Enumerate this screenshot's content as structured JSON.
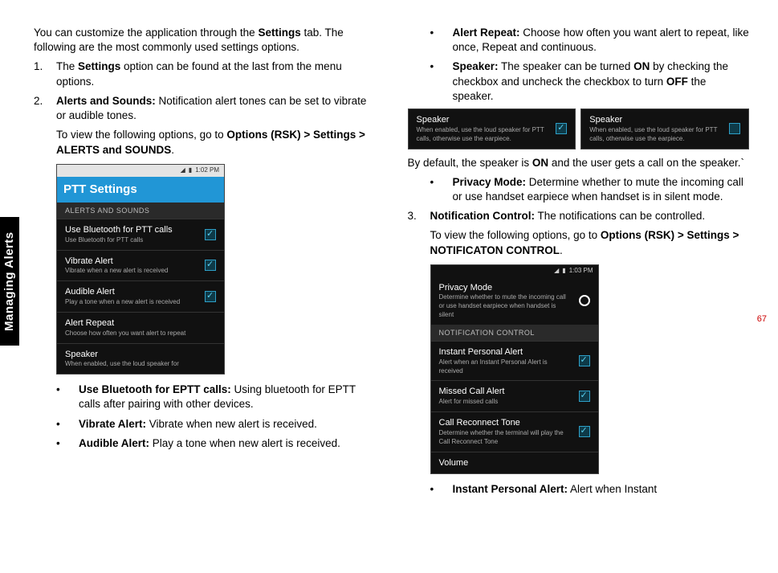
{
  "side_tab": "Managing Alerts",
  "page_number": "67",
  "col1": {
    "intro_a": "You can customize the application through the ",
    "intro_b": "Settings",
    "intro_c": " tab. The following are the most commonly used settings options.",
    "li1_num": "1.",
    "li1_a": "The ",
    "li1_b": "Settings",
    "li1_c": " option can be found at the last from the menu options.",
    "li2_num": "2.",
    "li2_a": "Alerts and Sounds:",
    "li2_b": " Notification alert tones can be set to vibrate or audible tones.",
    "li2_sub_a": "To view the following options, go to ",
    "li2_sub_b": "Options (RSK) > Settings > ALERTS and SOUNDS",
    "li2_sub_c": ".",
    "b1_t": "Use Bluetooth for EPTT calls:",
    "b1_d": " Using bluetooth for EPTT calls after pairing with other devices.",
    "b2_t": "Vibrate Alert:",
    "b2_d": " Vibrate when new alert is received.",
    "b3_t": "Audible Alert:",
    "b3_d": " Play a tone when new alert is received."
  },
  "shot1": {
    "time": "1:02 PM",
    "title": "PTT Settings",
    "section": "ALERTS AND SOUNDS",
    "r1t": "Use Bluetooth for PTT calls",
    "r1s": "Use Bluetooth for PTT calls",
    "r2t": "Vibrate Alert",
    "r2s": "Vibrate when a new alert is received",
    "r3t": "Audible Alert",
    "r3s": "Play a tone when a new alert is received",
    "r4t": "Alert Repeat",
    "r4s": "Choose how often you want alert to repeat",
    "r5t": "Speaker",
    "r5s": "When enabled, use the loud speaker for"
  },
  "col2": {
    "b4_t": "Alert Repeat:",
    "b4_d": " Choose how often you want alert to repeat, like once, Repeat and continuous.",
    "b5_t": "Speaker:",
    "b5_da": " The speaker can be turned ",
    "b5_on": "ON",
    "b5_db": " by checking the checkbox and uncheck the checkbox to turn ",
    "b5_off": "OFF",
    "b5_dc": " the speaker.",
    "speaker_note_a": "By default, the speaker is ",
    "speaker_note_b": "ON",
    "speaker_note_c": " and the user gets a call on the speaker.`",
    "b6_t": "Privacy Mode:",
    "b6_d": " Determine whether to mute the incoming call or use handset earpiece when handset is in silent mode.",
    "li3_num": "3.",
    "li3_a": "Notification Control:",
    "li3_b": " The notifications can be controlled.",
    "li3_sub_a": "To view the following options, go to ",
    "li3_sub_b": "Options (RSK) > Settings > NOTIFICATON CONTROL",
    "li3_sub_c": ".",
    "b7_t": "Instant Personal Alert:",
    "b7_d": " Alert when Instant"
  },
  "speaker_shots": {
    "title": "Speaker",
    "sub": "When enabled, use the loud speaker for PTT calls, otherwise use the earpiece."
  },
  "shot2": {
    "time": "1:03 PM",
    "r0t": "Privacy Mode",
    "r0s": "Determine whether to mute the incoming call or use handset earpiece when handset is silent",
    "section": "NOTIFICATION CONTROL",
    "r1t": "Instant Personal Alert",
    "r1s": "Alert when an Instant Personal Alert is received",
    "r2t": "Missed Call Alert",
    "r2s": "Alert for missed calls",
    "r3t": "Call Reconnect Tone",
    "r3s": "Determine whether the terminal will play the Call Reconnect Tone",
    "r4t": "Volume"
  }
}
